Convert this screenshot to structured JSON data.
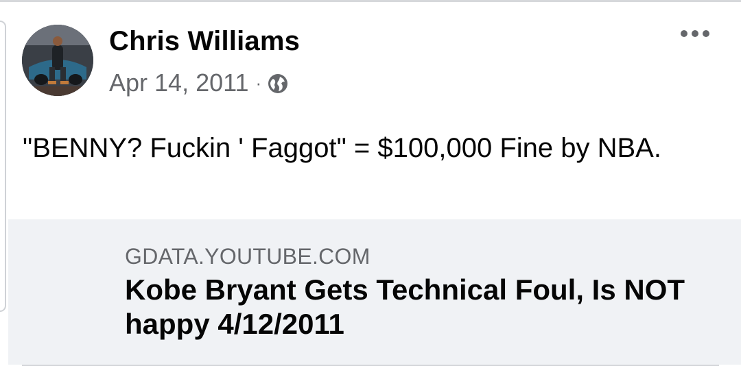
{
  "post": {
    "author": "Chris Williams",
    "date": "Apr 14, 2011",
    "separator": "·",
    "privacy_icon": "globe-icon",
    "more_icon": "more-options-icon",
    "text": "\"BENNY? Fuckin ' Faggot\" = $100,000 Fine by NBA."
  },
  "link_preview": {
    "domain": "GDATA.YOUTUBE.COM",
    "title": "Kobe Bryant Gets Technical Foul, Is NOT happy 4/12/2011"
  }
}
